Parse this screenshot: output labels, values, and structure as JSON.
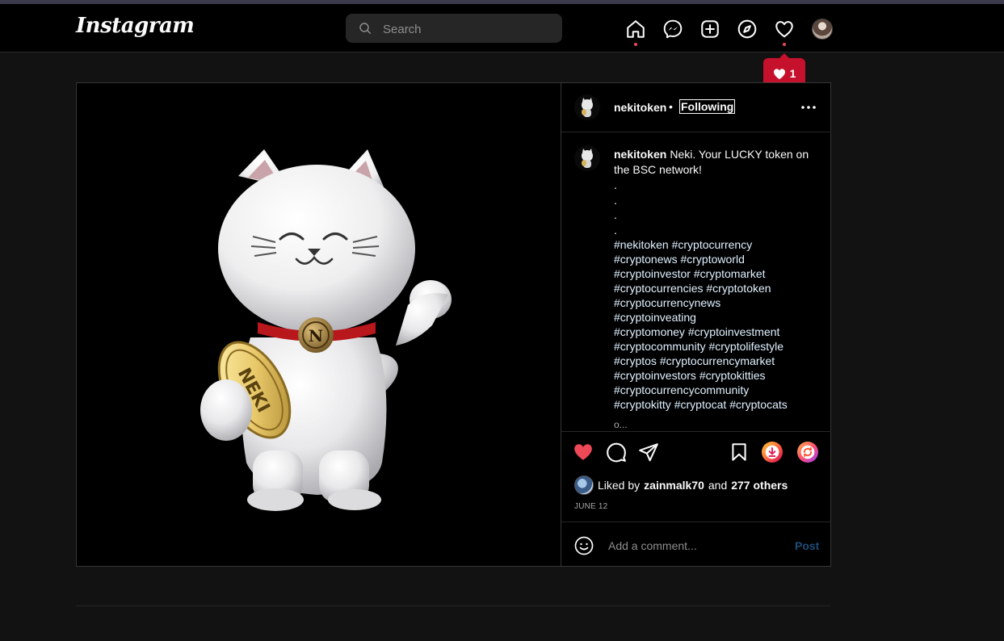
{
  "nav": {
    "logo": "Instagram",
    "search_placeholder": "Search",
    "notification_count": "1"
  },
  "post": {
    "username": "nekitoken",
    "separator": "•",
    "follow_status": "Following",
    "caption_text": "Neki. Your LUCKY token on the BSC network!",
    "caption_dots": [
      ".",
      ".",
      ".",
      "."
    ],
    "hashtag_lines": [
      [
        "#nekitoken",
        "#cryptocurrency"
      ],
      [
        "#cryptonews",
        "#cryptoworld"
      ],
      [
        "#cryptoinvestor",
        "#cryptomarket"
      ],
      [
        "#cryptocurrencies",
        "#cryptotoken"
      ],
      [
        "#cryptocurrencynews"
      ],
      [
        "#cryptoinveating"
      ],
      [
        "#cryptomoney",
        "#cryptoinvestment"
      ],
      [
        "#cryptocommunity",
        "#cryptolifestyle"
      ],
      [
        "#cryptos",
        "#cryptocurrencymarket"
      ],
      [
        "#cryptoinvestors",
        "#cryptokitties"
      ],
      [
        "#cryptocurrencycommunity"
      ],
      [
        "#cryptokitty",
        "#cryptocat",
        "#cryptocats"
      ]
    ],
    "more_text": "o...",
    "likes": {
      "prefix": "Liked by",
      "user": "zainmalk70",
      "conjunction": "and",
      "others": "277 others"
    },
    "date": "JUNE 12",
    "comment_placeholder": "Add a comment...",
    "post_button": "Post",
    "coin_text": "NEKI",
    "collar_letter": "N"
  },
  "colors": {
    "like_red": "#ed4956",
    "notif_red": "#c5112b",
    "link_blue": "#e0f1ff",
    "post_button_disabled": "#1e4d78"
  }
}
